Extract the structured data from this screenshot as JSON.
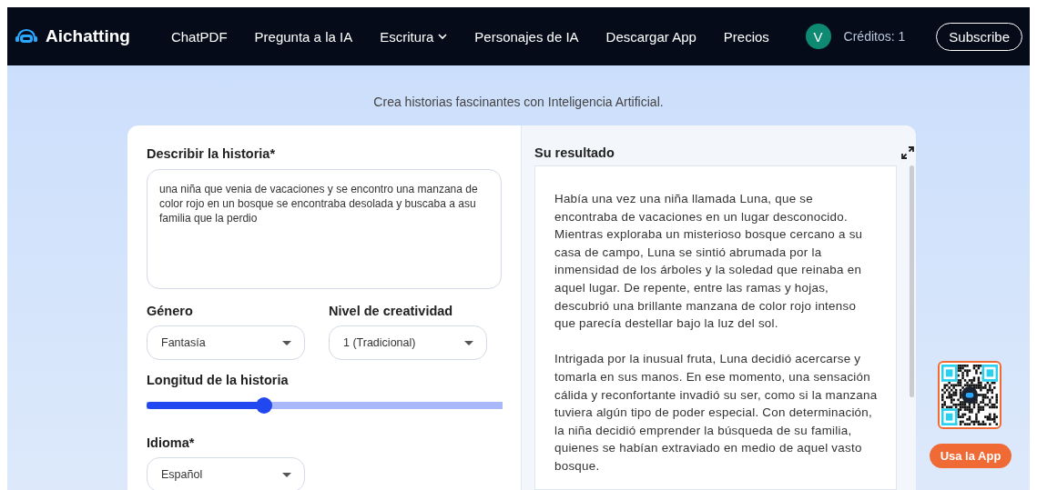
{
  "nav": {
    "brand": "Aichatting",
    "links": [
      {
        "label": "ChatPDF",
        "kind": "link"
      },
      {
        "label": "Pregunta a la IA",
        "kind": "link"
      },
      {
        "label": "Escritura",
        "kind": "dropdown"
      },
      {
        "label": "Personajes de IA",
        "kind": "link"
      },
      {
        "label": "Descargar App",
        "kind": "link"
      },
      {
        "label": "Precios",
        "kind": "link"
      }
    ],
    "avatar": "V",
    "credits": "Créditos: 1",
    "subscribe": "Subscribe"
  },
  "subtitle": "Crea historias fascinantes con Inteligencia Artificial.",
  "form": {
    "description_label": "Describir la historia*",
    "description_value": "una niña que venia de vacaciones y se encontro una manzana de color rojo en un bosque se encontraba desolada y buscaba a asu familia que la perdio",
    "genre_label": "Género",
    "genre_value": "Fantasía",
    "creativity_label": "Nivel de creatividad",
    "creativity_value": "1 (Tradicional)",
    "length_label": "Longitud de la historia",
    "length": {
      "level": 0.33
    },
    "language_label": "Idioma*",
    "language_value": "Español"
  },
  "result": {
    "title": "Su resultado",
    "paragraphs": [
      "Había una vez una niña llamada Luna, que se encontraba de vacaciones en un lugar desconocido. Mientras exploraba un misterioso bosque cercano a su casa de campo, Luna se sintió abrumada por la inmensidad de los árboles y la soledad que reinaba en aquel lugar. De repente, entre las ramas y hojas, descubrió una brillante manzana de color rojo intenso que parecía destellar bajo la luz del sol.",
      "Intrigada por la inusual fruta, Luna decidió acercarse y tomarla en sus manos. En ese momento, una sensación cálida y reconfortante invadió su ser, como si la manzana tuviera algún tipo de poder especial. Con determinación, la niña decidió emprender la búsqueda de su familia, quienes se habían extraviado en medio de aquel vasto bosque."
    ]
  },
  "app_button": "Usa la App"
}
